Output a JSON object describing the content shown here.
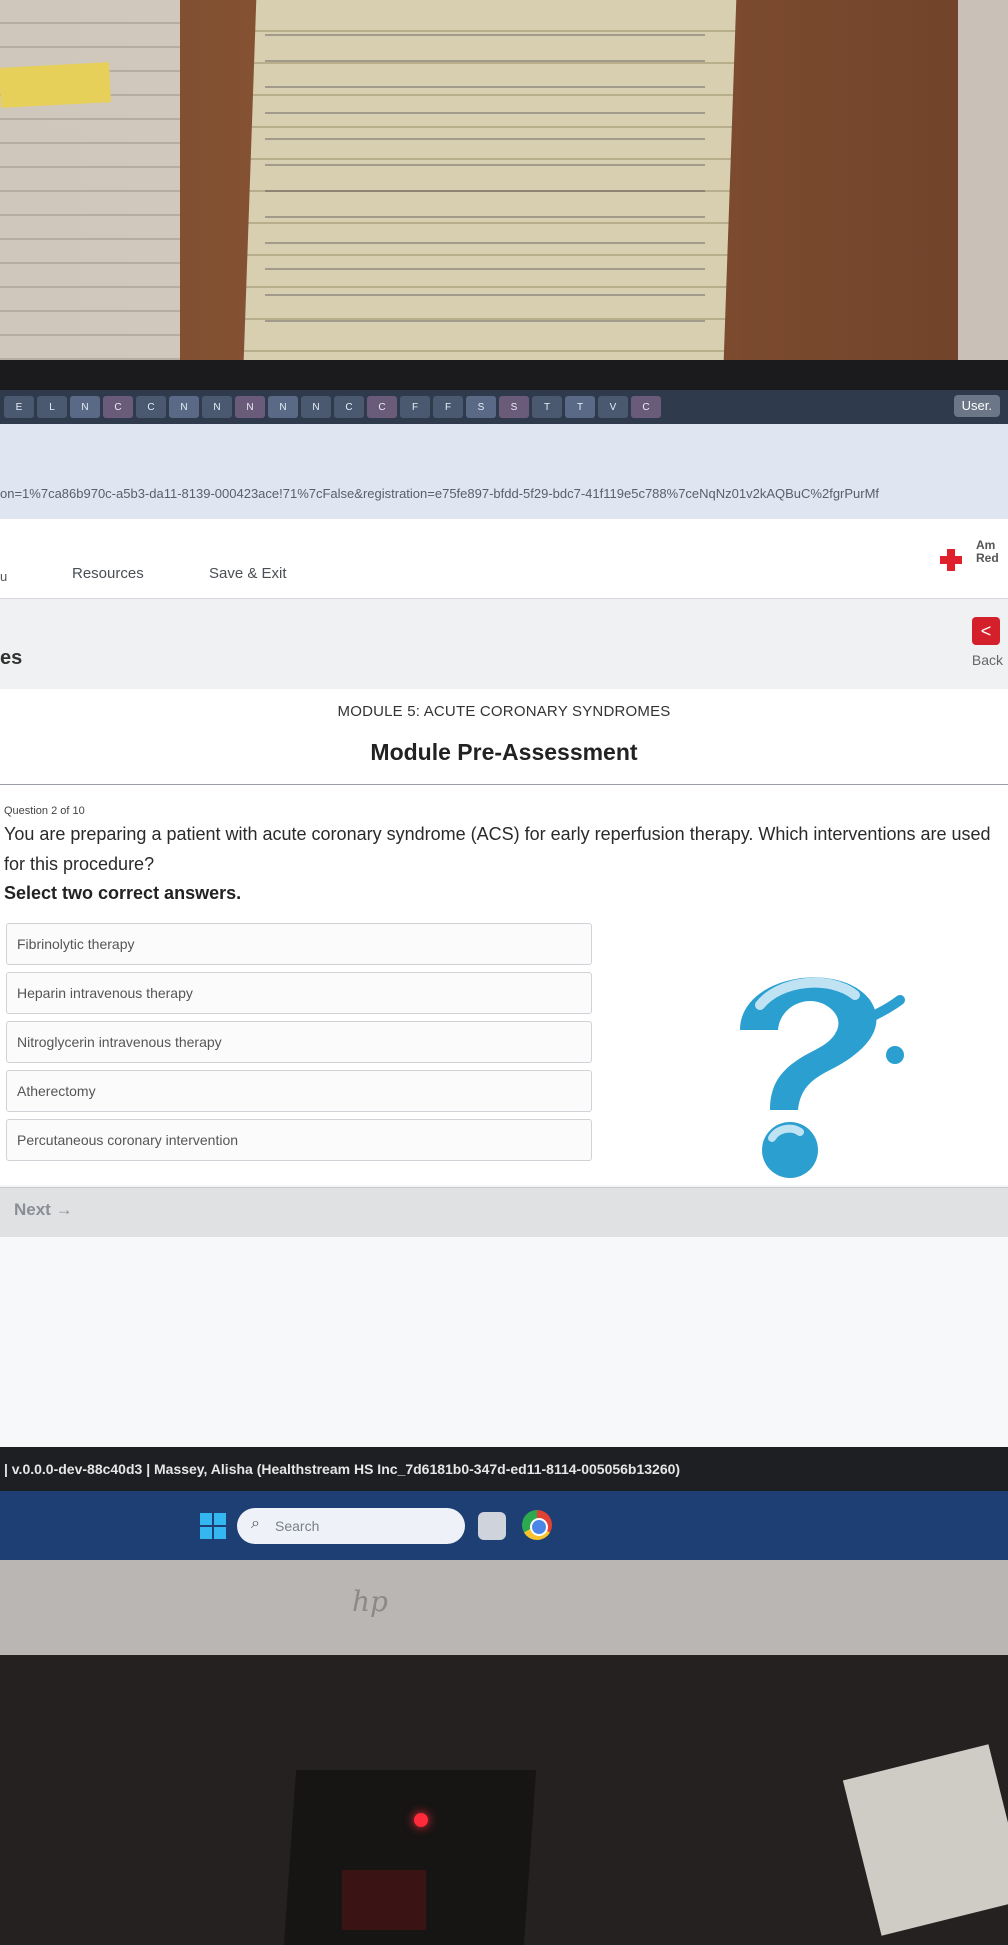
{
  "browser": {
    "tabs": [
      {
        "label": "E"
      },
      {
        "label": "L"
      },
      {
        "label": "N"
      },
      {
        "label": "C"
      },
      {
        "label": "C"
      },
      {
        "label": "N"
      },
      {
        "label": "N"
      },
      {
        "label": "N"
      },
      {
        "label": "N"
      },
      {
        "label": "N"
      },
      {
        "label": "C"
      },
      {
        "label": "C"
      },
      {
        "label": "F"
      },
      {
        "label": "F"
      },
      {
        "label": "S"
      },
      {
        "label": "S"
      },
      {
        "label": "T"
      },
      {
        "label": "T"
      },
      {
        "label": "V"
      },
      {
        "label": "C"
      }
    ],
    "user_label": "User.",
    "url": "on=1%7ca86b970c-a5b3-da11-8139-000423ace!71%7cFalse&registration=e75fe897-bfdd-5f29-bdc7-41f119e5c788%7ceNqNz01v2kAQBuC%2fgrPurMf"
  },
  "app": {
    "nav_partial": "u",
    "nav": {
      "resources": "Resources",
      "save_exit": "Save & Exit"
    },
    "brand_text": "Am Red",
    "section_partial": "es",
    "back_icon": "<",
    "back_label": "Back"
  },
  "module": {
    "kicker": "MODULE 5: ACUTE CORONARY SYNDROMES",
    "title": "Module Pre-Assessment"
  },
  "question": {
    "number": "Question 2 of 10",
    "text": "You are preparing a patient with acute coronary syndrome (ACS) for early reperfusion therapy. Which interventions are used for this procedure?",
    "instruction": "Select two correct answers.",
    "options": [
      {
        "label": "Fibrinolytic therapy"
      },
      {
        "label": "Heparin intravenous therapy"
      },
      {
        "label": "Nitroglycerin intravenous therapy"
      },
      {
        "label": "Atherectomy"
      },
      {
        "label": "Percutaneous coronary intervention"
      }
    ]
  },
  "next_label": "Next →",
  "footer_text": "| v.0.0.0-dev-88c40d3 | Massey, Alisha (Healthstream HS Inc_7d6181b0-347d-ed11-8114-005056b13260)",
  "taskbar": {
    "search_placeholder": "Search",
    "search_glyph": "⌕"
  },
  "accent_colors": {
    "brand_red": "#d3202b",
    "question_mark_blue": "#2a9fd0",
    "taskbar": "#1e3f73"
  }
}
